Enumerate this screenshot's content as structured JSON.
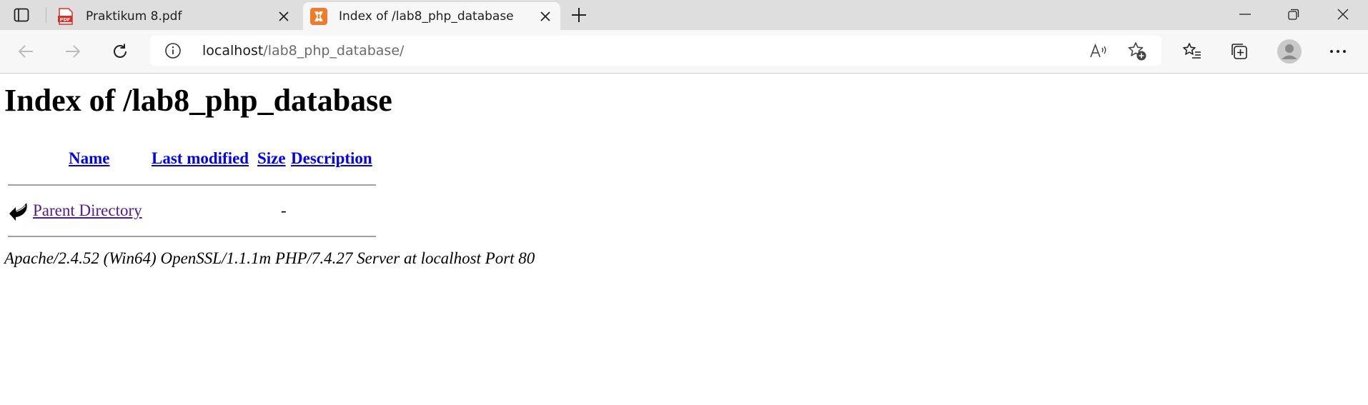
{
  "browser": {
    "tabs": [
      {
        "title": "Praktikum 8.pdf",
        "favicon": "pdf-icon",
        "active": false,
        "favicon_text": "PDF"
      },
      {
        "title": "Index of /lab8_php_database",
        "favicon": "xampp-icon",
        "active": true
      }
    ],
    "address": {
      "host": "localhost",
      "path": "/lab8_php_database/"
    }
  },
  "page": {
    "heading": "Index of /lab8_php_database",
    "columns": {
      "name": "Name",
      "last_modified": "Last modified",
      "size": "Size",
      "description": "Description"
    },
    "rows": [
      {
        "name": "Parent Directory",
        "last_modified": "",
        "size": "-",
        "description": "",
        "icon": "back-arrow-icon"
      }
    ],
    "server_signature": "Apache/2.4.52 (Win64) OpenSSL/1.1.1m PHP/7.4.27 Server at localhost Port 80"
  },
  "colors": {
    "link": "#0000ee",
    "visited_link": "#551a8b",
    "tabstrip": "#dedede",
    "xampp_orange": "#f27b2a",
    "pdf_red": "#d93025"
  }
}
